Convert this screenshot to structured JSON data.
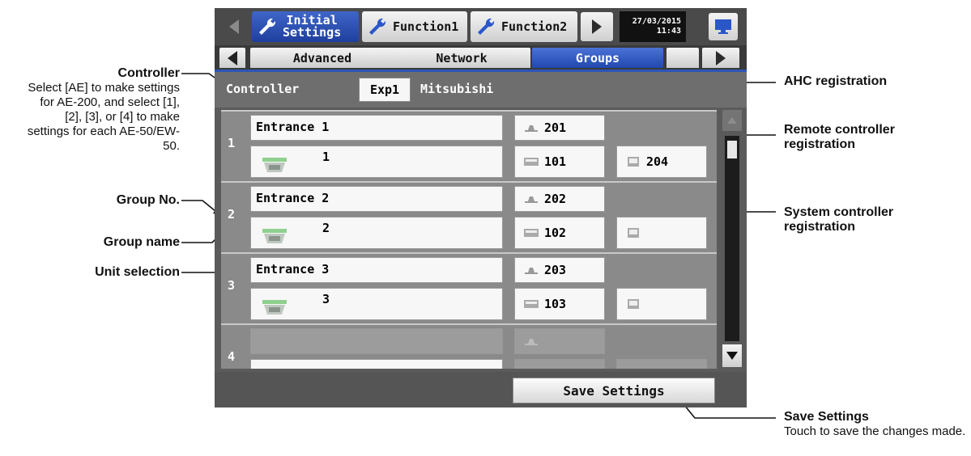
{
  "topbar": {
    "tabs": [
      {
        "label_line1": "Initial",
        "label_line2": "Settings",
        "active": true
      },
      {
        "label": "Function1",
        "active": false
      },
      {
        "label": "Function2",
        "active": false
      }
    ],
    "date": "27/03/2015",
    "time": "11:43"
  },
  "subtabs": [
    "Advanced",
    "Network",
    "Groups"
  ],
  "active_subtab": "Groups",
  "controller": {
    "label": "Controller",
    "button": "Exp1",
    "name": "Mitsubishi"
  },
  "groups": [
    {
      "no": "1",
      "name": "Entrance 1",
      "unit": "1",
      "ahc": "201",
      "rc": "101",
      "sc": "204"
    },
    {
      "no": "2",
      "name": "Entrance 2",
      "unit": "2",
      "ahc": "202",
      "rc": "102",
      "sc": ""
    },
    {
      "no": "3",
      "name": "Entrance 3",
      "unit": "3",
      "ahc": "203",
      "rc": "103",
      "sc": ""
    },
    {
      "no": "4",
      "name": "",
      "unit": "",
      "ahc": "",
      "rc": "",
      "sc": ""
    }
  ],
  "save_button": "Save Settings",
  "callouts": {
    "controller_title": "Controller",
    "controller_desc": "Select [AE] to make settings for AE-200, and select [1], [2], [3], or [4] to make settings for each AE-50/EW-50.",
    "group_no": "Group No.",
    "group_name": "Group name",
    "unit_selection": "Unit selection",
    "ahc_registration": "AHC registration",
    "remote_controller": "Remote controller registration",
    "system_controller": "System controller registration",
    "save_title": "Save Settings",
    "save_desc": "Touch to save the changes made."
  }
}
